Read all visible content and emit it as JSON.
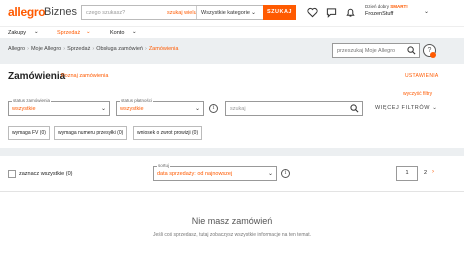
{
  "header": {
    "logo": "allegro",
    "logo_suffix": "Biznes",
    "search_placeholder": "czego szukasz?",
    "search_where": "szukaj wielu",
    "category": "Wszystkie kategorie",
    "search_button": "SZUKAJ",
    "user_greeting": "Dzień dobry",
    "smart_badge": "SMART!",
    "user_name": "FrozenStuff",
    "icons": [
      "heart-icon",
      "chat-icon",
      "bell-icon",
      "cart-icon"
    ]
  },
  "nav": {
    "items": [
      {
        "label": "Zakupy",
        "active": false
      },
      {
        "label": "Sprzedaż",
        "active": true
      },
      {
        "label": "Konto",
        "active": false
      }
    ]
  },
  "breadcrumb": {
    "items": [
      "Allegro",
      "Moje Allegro",
      "Sprzedaż",
      "Obsługa zamówień"
    ],
    "current": "Zamówienia"
  },
  "crumb_search": {
    "placeholder": "przeszukaj Moje Allegro"
  },
  "filters": {
    "title": "Zamówienia",
    "learn_link": "Poznaj zamówienia",
    "settings_link": "USTAWIENIA",
    "clear_filters": "wyczyść filtry",
    "status_order": {
      "label": "status zamówienia",
      "value": "wszystkie"
    },
    "status_payment": {
      "label": "status płatności",
      "value": "wszystkie"
    },
    "query_placeholder": "szukaj",
    "more_filters": "WIĘCEJ FILTRÓW",
    "chips": [
      "wymaga FV (0)",
      "wymaga numeru przesyłki (0)",
      "wniosek o zwrot prowizji (0)"
    ]
  },
  "list": {
    "select_all": "zaznacz wszystkie (0)",
    "sort": {
      "label": "sortuj",
      "value": "data sprzedaży: od najnowszej"
    },
    "page": "1",
    "page_total": "2",
    "empty_title": "Nie masz zamówień",
    "empty_desc": "Jeśli coś sprzedasz, tutaj zobaczysz wszystkie informacje na ten temat."
  },
  "colors": {
    "accent": "#ff5a00",
    "background": "#eceff1"
  }
}
